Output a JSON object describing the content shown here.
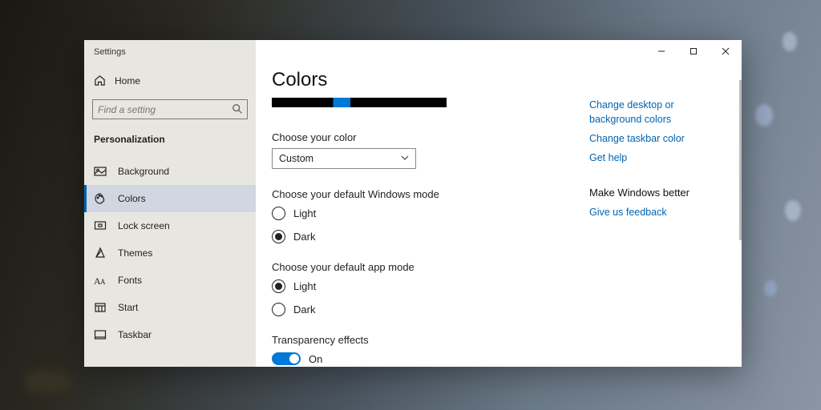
{
  "app_title": "Settings",
  "home_label": "Home",
  "search_placeholder": "Find a setting",
  "section": "Personalization",
  "nav": [
    {
      "label": "Background"
    },
    {
      "label": "Colors"
    },
    {
      "label": "Lock screen"
    },
    {
      "label": "Themes"
    },
    {
      "label": "Fonts"
    },
    {
      "label": "Start"
    },
    {
      "label": "Taskbar"
    }
  ],
  "page_title": "Colors",
  "choose_color_label": "Choose your color",
  "choose_color_value": "Custom",
  "win_mode_label": "Choose your default Windows mode",
  "win_mode": {
    "light": "Light",
    "dark": "Dark",
    "selected": "dark"
  },
  "app_mode_label": "Choose your default app mode",
  "app_mode": {
    "light": "Light",
    "dark": "Dark",
    "selected": "light"
  },
  "transparency_label": "Transparency effects",
  "transparency_state": "On",
  "rail": {
    "link1": "Change desktop or background colors",
    "link2": "Change taskbar color",
    "link3": "Get help",
    "heading": "Make Windows better",
    "link4": "Give us feedback"
  },
  "colors": {
    "accent": "#0078d7",
    "link": "#0063b1"
  }
}
